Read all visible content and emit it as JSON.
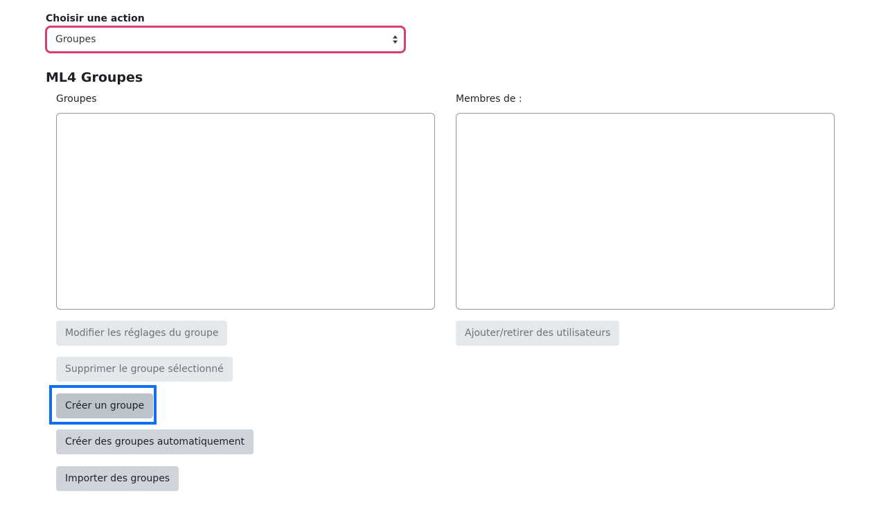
{
  "action_chooser": {
    "label": "Choisir une action",
    "selected_value": "Groupes",
    "caret_icon": "sort-caret-icon",
    "border_color": "#d6406f"
  },
  "section": {
    "title": "ML4 Groupes"
  },
  "groups_column": {
    "label": "Groupes",
    "items": []
  },
  "members_column": {
    "label": "Membres de :",
    "items": []
  },
  "buttons": {
    "edit_group": "Modifier les réglages du groupe",
    "delete_group": "Supprimer le groupe sélectionné",
    "create_group": "Créer un groupe",
    "auto_create": "Créer des groupes automatiquement",
    "import_groups": "Importer des groupes",
    "add_remove_users": "Ajouter/retirer des utilisateurs"
  },
  "colors": {
    "focus_ring": "#0f6fec",
    "button_secondary": "#ced4da",
    "button_disabled": "#e5e8eb"
  }
}
